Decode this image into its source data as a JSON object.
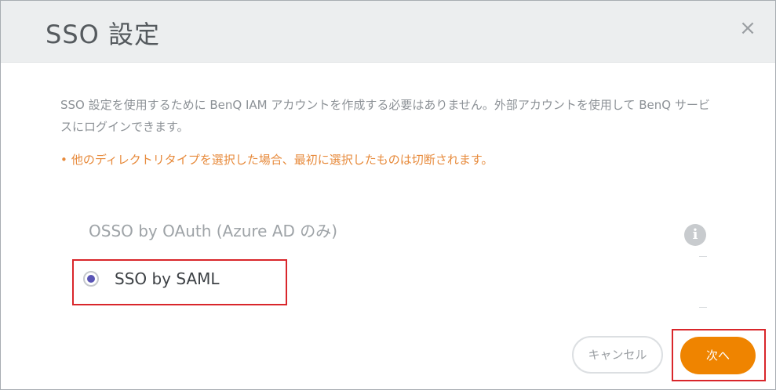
{
  "dialog": {
    "title": "SSO 設定",
    "close_glyph": "×",
    "description": "SSO 設定を使用するために BenQ IAM アカウントを作成する必要はありません。外部アカウントを使用して BenQ サービスにログインできます。",
    "warning": "他のディレクトリタイプを選択した場合、最初に選択したものは切断されます。",
    "warning_bullet": "•",
    "options": [
      {
        "label": "OSSO by OAuth (Azure AD のみ)",
        "selected": false
      },
      {
        "label": "SSO by SAML",
        "selected": true
      }
    ],
    "info_glyph": "i",
    "buttons": {
      "cancel": "キャンセル",
      "next": "次へ"
    }
  },
  "colors": {
    "accent": "#ef8400",
    "warning": "#e78a3b",
    "highlight_border": "#d9262b",
    "radio_selected": "#5a55b5",
    "header_bg": "#eceeef"
  },
  "icons": {
    "close": "close-icon",
    "info": "info-icon",
    "radio": "radio-selected-icon"
  }
}
